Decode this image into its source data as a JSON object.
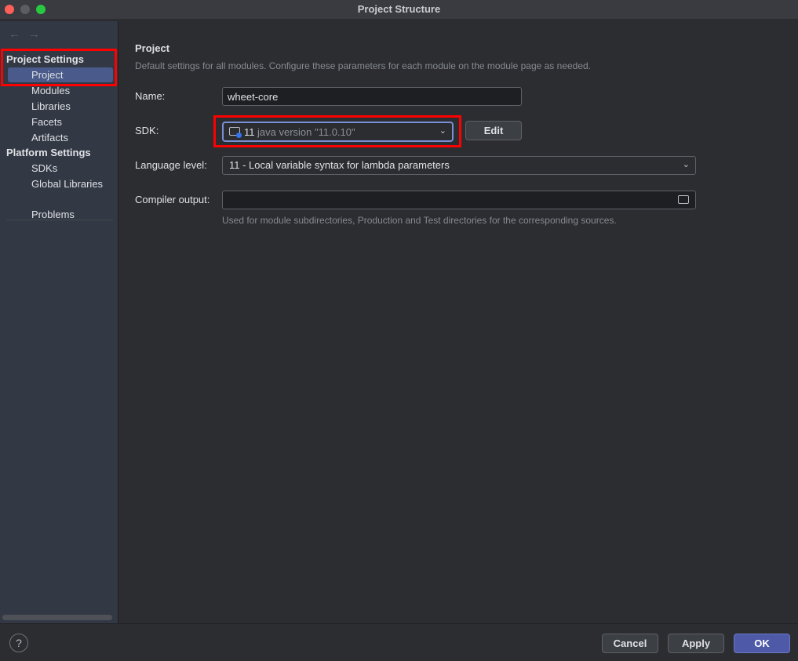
{
  "window": {
    "title": "Project Structure"
  },
  "colors": {
    "accent": "#3574f0",
    "selection": "#4a5a8a",
    "highlight": "#ff0000",
    "ok_button": "#4e5aa8"
  },
  "sidebar": {
    "back_icon": "←",
    "forward_icon": "→",
    "project_settings_header": "Project Settings",
    "project_items": [
      "Project",
      "Modules",
      "Libraries",
      "Facets",
      "Artifacts"
    ],
    "selected_item": "Project",
    "platform_settings_header": "Platform Settings",
    "platform_items": [
      "SDKs",
      "Global Libraries"
    ],
    "problems": "Problems"
  },
  "main": {
    "heading": "Project",
    "subtitle": "Default settings for all modules. Configure these parameters for each module on the module page as needed.",
    "name_label": "Name:",
    "name_value": "wheet-core",
    "sdk_label": "SDK:",
    "sdk_version": "11",
    "sdk_detail": "java version \"11.0.10\"",
    "edit_button": "Edit",
    "language_level_label": "Language level:",
    "language_level_value": "11 - Local variable syntax for lambda parameters",
    "compiler_output_label": "Compiler output:",
    "compiler_output_value": "",
    "compiler_output_hint": "Used for module subdirectories, Production and Test directories for the corresponding sources."
  },
  "footer": {
    "help": "?",
    "cancel": "Cancel",
    "apply": "Apply",
    "ok": "OK"
  }
}
